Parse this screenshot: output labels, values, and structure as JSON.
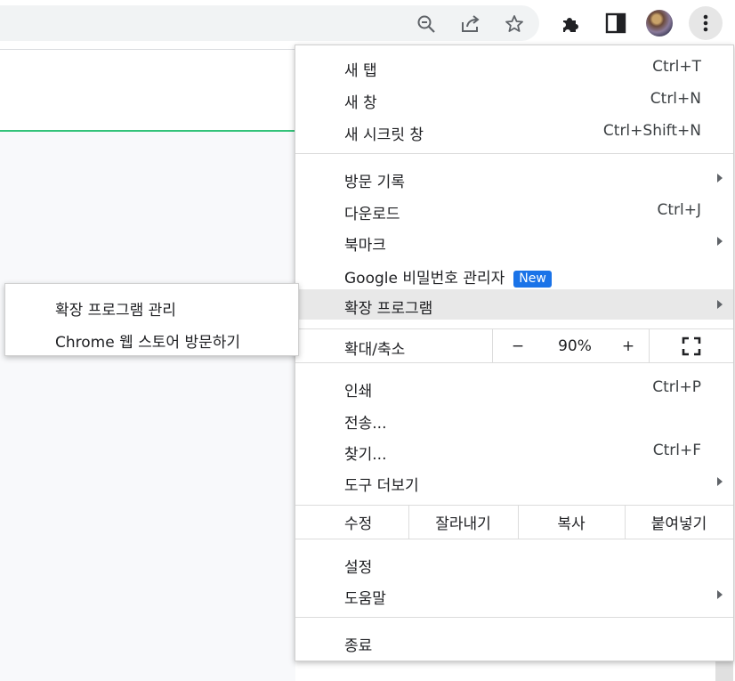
{
  "menu": {
    "new_tab": {
      "label": "새 탭",
      "shortcut": "Ctrl+T"
    },
    "new_window": {
      "label": "새 창",
      "shortcut": "Ctrl+N"
    },
    "new_incognito": {
      "label": "새 시크릿 창",
      "shortcut": "Ctrl+Shift+N"
    },
    "history": {
      "label": "방문 기록"
    },
    "downloads": {
      "label": "다운로드",
      "shortcut": "Ctrl+J"
    },
    "bookmarks": {
      "label": "북마크"
    },
    "passwords": {
      "label": "Google 비밀번호 관리자",
      "badge": "New"
    },
    "extensions": {
      "label": "확장 프로그램"
    },
    "zoom": {
      "label": "확대/축소",
      "minus": "−",
      "value": "90%",
      "plus": "+"
    },
    "print": {
      "label": "인쇄",
      "shortcut": "Ctrl+P"
    },
    "cast": {
      "label": "전송..."
    },
    "find": {
      "label": "찾기...",
      "shortcut": "Ctrl+F"
    },
    "more_tools": {
      "label": "도구 더보기"
    },
    "edit": {
      "label": "수정",
      "cut": "잘라내기",
      "copy": "복사",
      "paste": "붙여넣기"
    },
    "settings": {
      "label": "설정"
    },
    "help": {
      "label": "도움말"
    },
    "exit": {
      "label": "종료"
    }
  },
  "submenu": {
    "manage_extensions": "확장 프로그램 관리",
    "web_store": "Chrome 웹 스토어 방문하기"
  },
  "toolbar": {
    "icons": [
      "zoom-icon",
      "share-icon",
      "bookmark-star-icon",
      "extensions-puzzle-icon",
      "side-panel-icon",
      "profile-avatar",
      "more-menu-icon"
    ]
  },
  "colors": {
    "badge_blue": "#1a73e8",
    "accent_green": "#34c37a",
    "hover_gray": "#e8e8e8"
  }
}
